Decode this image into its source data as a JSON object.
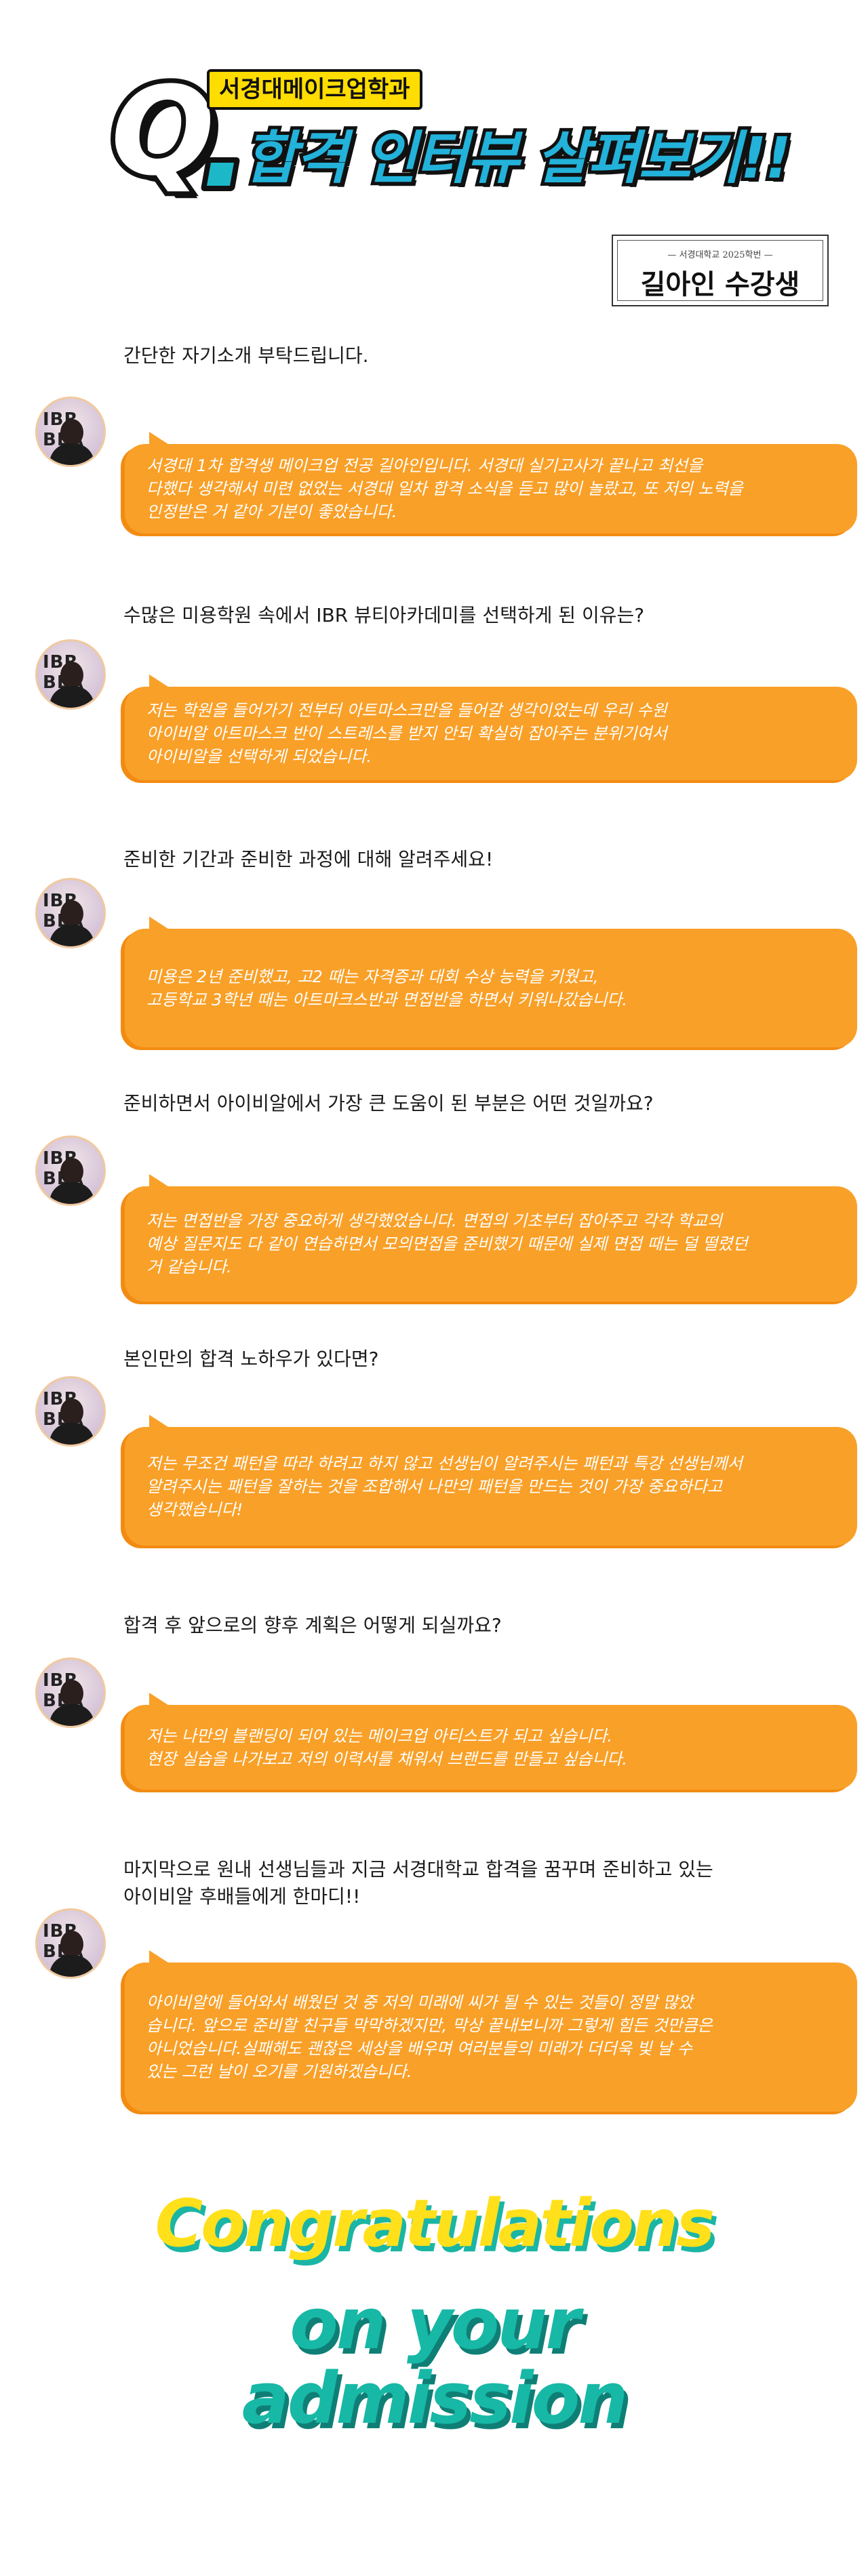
{
  "header": {
    "q_letter": "Q",
    "subtitle": "서경대메이크업학과",
    "title": "합격 인터뷰 살펴보기!!"
  },
  "name_card": {
    "year": "— 서경대학교 2025학번 —",
    "name": "길아인 수강생"
  },
  "avatar": {
    "logo_text": "IBR BEA"
  },
  "qa": [
    {
      "question": "간단한 자기소개 부탁드립니다.",
      "answer": "서경대 1차 합격생 메이크업 전공 길아인입니다. 서경대 실기고사가 끝나고 최선을\n다했다 생각해서 미련 없었는 서경대 일차 합격 소식을 듣고 많이 놀랐고, 또 저의 노력을\n인정받은 거 같아 기분이 좋았습니다."
    },
    {
      "question": "수많은 미용학원 속에서 IBR 뷰티아카데미를 선택하게 된 이유는?",
      "answer": "저는 학원을 들어가기 전부터 아트마스크만을 들어갈 생각이었는데 우리 수원\n아이비알 아트마스크 반이 스트레스를 받지 안되 확실히 잡아주는 분위기여서\n아이비알을 선택하게 되었습니다."
    },
    {
      "question": "준비한 기간과 준비한 과정에 대해 알려주세요!",
      "answer": "미용은 2년 준비했고, 고2 때는 자격증과 대회 수상 능력을 키웠고,\n고등학교 3학년 때는 아트마크스반과 면접반을 하면서 키워나갔습니다."
    },
    {
      "question": "준비하면서 아이비알에서 가장 큰 도움이 된 부분은 어떤 것일까요?",
      "answer": "저는 면접반을 가장 중요하게 생각했었습니다. 면접의 기초부터 잡아주고 각각 학교의\n예상 질문지도 다 같이 연습하면서 모의면접을 준비했기 때문에 실제 면접 때는 덜 떨렸던\n거 같습니다."
    },
    {
      "question": "본인만의 합격 노하우가 있다면?",
      "answer": "저는 무조건 패턴을 따라 하려고 하지 않고 선생님이 알려주시는 패턴과 특강 선생님께서\n알려주시는 패턴을 잘하는 것을 조합해서 나만의 패턴을 만드는 것이 가장 중요하다고\n생각했습니다!"
    },
    {
      "question": "합격 후 앞으로의 향후 계획은 어떻게 되실까요?",
      "answer": "저는 나만의 블랜딩이 되어 있는 메이크업 아티스트가 되고 싶습니다.\n현장 실습을 나가보고 저의 이력서를 채워서 브랜드를 만들고 싶습니다."
    },
    {
      "question": "마지막으로 원내 선생님들과 지금 서경대학교 합격을 꿈꾸며 준비하고 있는\n아이비알 후배들에게 한마디!!",
      "answer": "아이비알에 들어와서 배웠던 것 중 저의 미래에 씨가 될 수 있는 것들이 정말 많았\n습니다. 앞으로 준비할 친구들 막막하겠지만, 막상 끝내보니까 그렇게 힘든 것만큼은\n아니었습니다.실패해도 괜찮은 세상을 배우며 여러분들의 미래가 더더욱 빛 날 수\n있는 그런 날이 오기를 기원하겠습니다."
    }
  ],
  "footer": {
    "congrats": "Congratulations",
    "on_your": "on your",
    "admission": "admission"
  },
  "colors": {
    "bubble": "#f9a028",
    "bubble_shadow": "#f28b12",
    "title_blue": "#23b2d9",
    "tag_yellow": "#ffdd00",
    "congrats_yellow": "#ffe01a",
    "teal": "#17b8a6"
  }
}
